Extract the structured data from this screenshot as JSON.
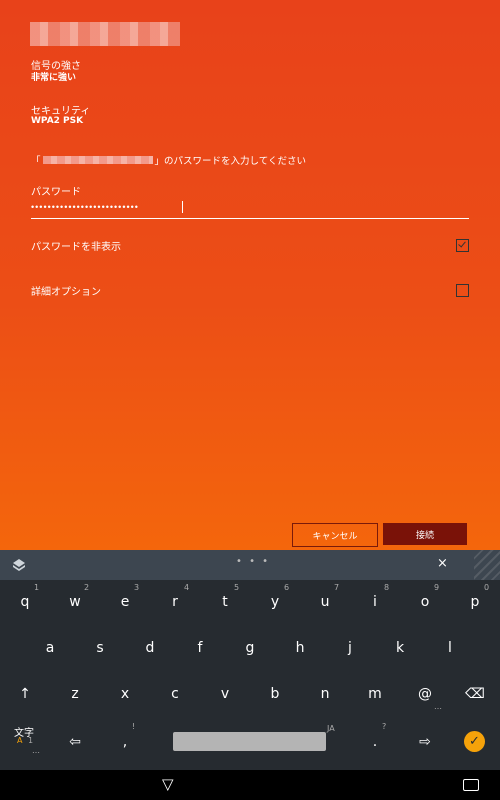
{
  "signal": {
    "label": "信号の強さ",
    "value": "非常に強い"
  },
  "security": {
    "label": "セキュリティ",
    "value": "WPA2 PSK"
  },
  "prompt": {
    "open": "「",
    "close": "」のパスワードを入力してください"
  },
  "password": {
    "label": "パスワード",
    "value": "••••••••••••••••••••••••••"
  },
  "options": {
    "hide_password": "パスワードを非表示",
    "advanced": "詳細オプション"
  },
  "buttons": {
    "cancel": "キャンセル",
    "connect": "接続"
  },
  "keyboard": {
    "row1": [
      {
        "k": "q",
        "s": "1"
      },
      {
        "k": "w",
        "s": "2"
      },
      {
        "k": "e",
        "s": "3"
      },
      {
        "k": "r",
        "s": "4"
      },
      {
        "k": "t",
        "s": "5"
      },
      {
        "k": "y",
        "s": "6"
      },
      {
        "k": "u",
        "s": "7"
      },
      {
        "k": "i",
        "s": "8"
      },
      {
        "k": "o",
        "s": "9"
      },
      {
        "k": "p",
        "s": "0"
      }
    ],
    "row2": [
      "a",
      "s",
      "d",
      "f",
      "g",
      "h",
      "j",
      "k",
      "l"
    ],
    "row3": [
      {
        "k": "↑"
      },
      {
        "k": "z"
      },
      {
        "k": "x"
      },
      {
        "k": "c"
      },
      {
        "k": "v"
      },
      {
        "k": "b"
      },
      {
        "k": "n"
      },
      {
        "k": "m"
      },
      {
        "k": "@",
        "s": "…"
      },
      {
        "k": "⌫"
      }
    ],
    "lang_key": {
      "main": "文字",
      "sub_a": "A",
      "sub_1": "1",
      "sub_dots": "…"
    },
    "left_arrow": "⇦",
    "comma": ",",
    "comma_sup": "!",
    "lang_tag": "JA",
    "period": ".",
    "period_sup": "?",
    "right_arrow": "⇨",
    "enter": "✓",
    "dots": "• • •",
    "close": "×"
  },
  "nav": {
    "back": "▽"
  }
}
